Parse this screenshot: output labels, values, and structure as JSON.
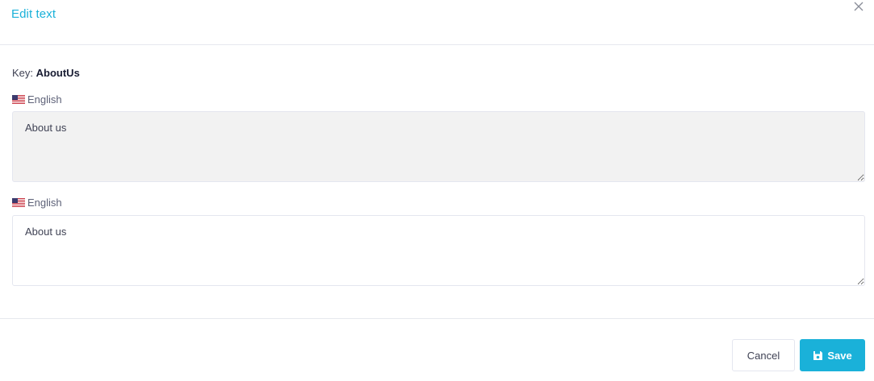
{
  "modal": {
    "title": "Edit text",
    "close_icon": "close-icon"
  },
  "key": {
    "label": "Key:",
    "value": "AboutUs"
  },
  "source": {
    "language": "English",
    "flag_icon": "us-flag-icon",
    "value": "About us"
  },
  "target": {
    "language": "English",
    "flag_icon": "us-flag-icon",
    "value": "About us"
  },
  "footer": {
    "cancel_label": "Cancel",
    "save_label": "Save",
    "save_icon": "floppy-disk-icon"
  },
  "colors": {
    "accent": "#1ab1d9",
    "readonly_bg": "#f2f2f2",
    "border": "#e4e6ef"
  }
}
